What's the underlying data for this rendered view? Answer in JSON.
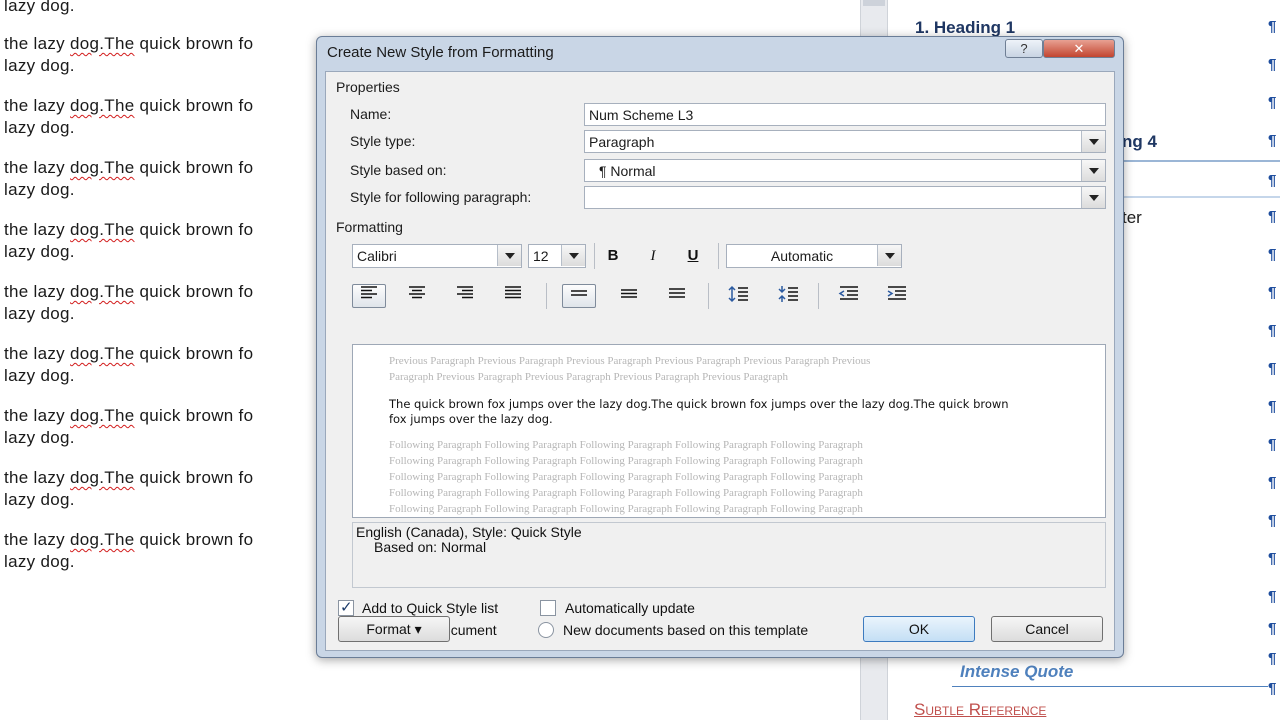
{
  "document": {
    "top_fragment": "lazy dog.",
    "line_pre": "the lazy ",
    "line_squig": "dog.The",
    "line_post": " quick brown fo",
    "line_second": "lazy dog."
  },
  "styles_pane": {
    "heading1": "1.  Heading 1",
    "heading4_fragment": "ng 4",
    "fragment_ter": "ter",
    "intense_quote": "Intense Quote",
    "subtle_reference": "Subtle Reference",
    "pilcrow": "¶"
  },
  "dialog": {
    "title": "Create New Style from Formatting",
    "help_label": "?",
    "close_label": "✕",
    "properties_label": "Properties",
    "name_label": "Name:",
    "name_value": "Num Scheme L3",
    "style_type_label": "Style type:",
    "style_type_value": "Paragraph",
    "based_on_label": "Style based on:",
    "based_on_value": "¶  Normal",
    "following_label": "Style for following paragraph:",
    "following_value": "",
    "formatting_label": "Formatting",
    "font_value": "Calibri",
    "size_value": "12",
    "bold_label": "B",
    "italic_label": "I",
    "underline_label": "U",
    "color_value": "Automatic",
    "preview_previous_1": "Previous Paragraph Previous Paragraph Previous Paragraph Previous Paragraph Previous Paragraph Previous",
    "preview_previous_2": "Paragraph Previous Paragraph Previous Paragraph Previous Paragraph Previous Paragraph",
    "preview_main": "The quick brown fox jumps over the lazy dog.The quick brown fox jumps over the lazy dog.The quick brown fox jumps over the lazy dog.",
    "preview_following": "Following Paragraph Following Paragraph Following Paragraph Following Paragraph Following Paragraph",
    "description_line1": "English (Canada), Style: Quick Style",
    "description_line2": "Based on: Normal",
    "add_quick_style_label": "Add to Quick Style list",
    "add_quick_style_checked": true,
    "auto_update_label": "Automatically update",
    "auto_update_checked": false,
    "only_this_doc_label": "Only in this document",
    "new_docs_label": "New documents based on this template",
    "format_button": "Format ▾",
    "ok_button": "OK",
    "cancel_button": "Cancel"
  }
}
